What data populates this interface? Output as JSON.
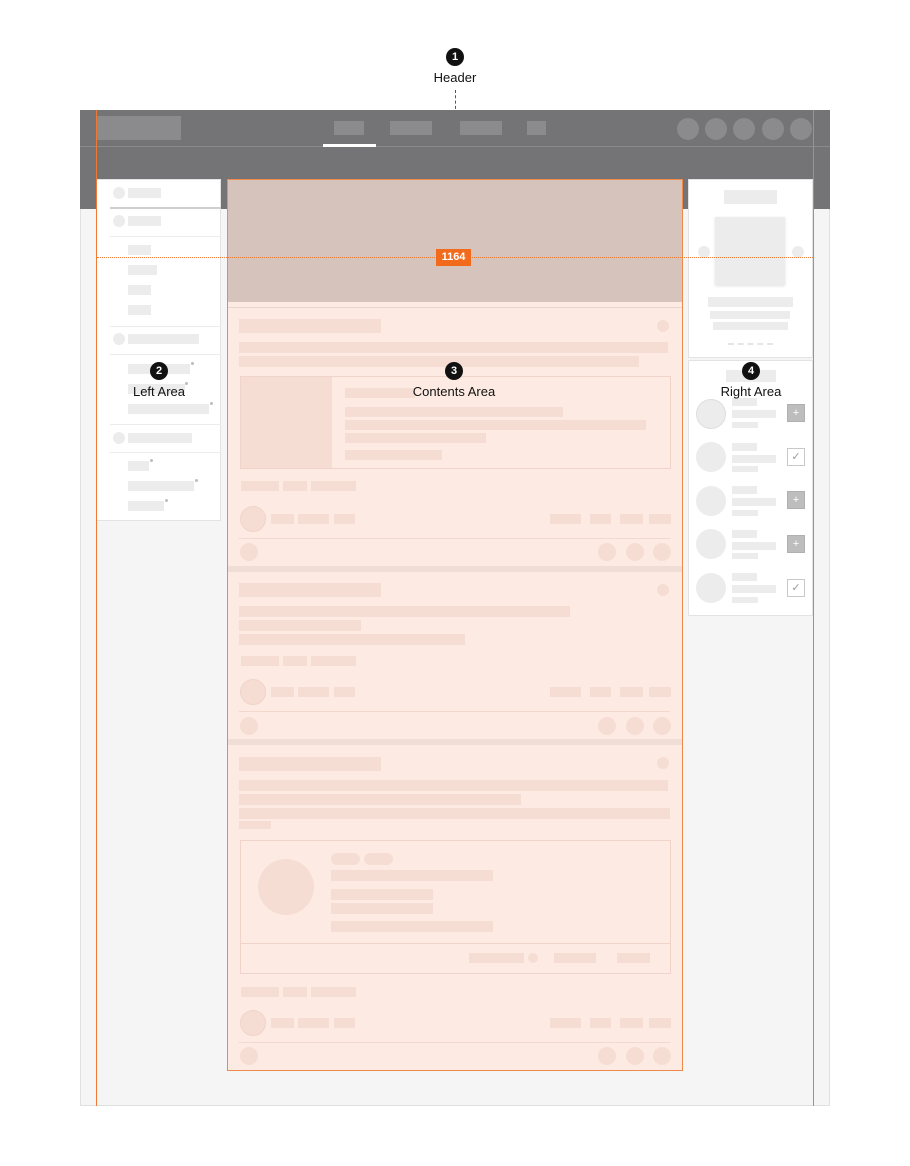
{
  "annotations": [
    {
      "num": "1",
      "label": "Header"
    },
    {
      "num": "2",
      "label": "Left Area"
    },
    {
      "num": "3",
      "label": "Contents Area"
    },
    {
      "num": "4",
      "label": "Right Area"
    }
  ],
  "dimension": {
    "value": "1164"
  },
  "right_area": {
    "follow_buttons": [
      {
        "state": "add",
        "glyph": "+"
      },
      {
        "state": "added",
        "glyph": "✓"
      },
      {
        "state": "add",
        "glyph": "+"
      },
      {
        "state": "add",
        "glyph": "+"
      },
      {
        "state": "added",
        "glyph": "✓"
      }
    ]
  },
  "colors": {
    "header": "#747376",
    "guide": "#f07a34",
    "contents_fill": "#fdebe3",
    "hero": "#d5c3bc",
    "badge": "#f26b1d"
  }
}
